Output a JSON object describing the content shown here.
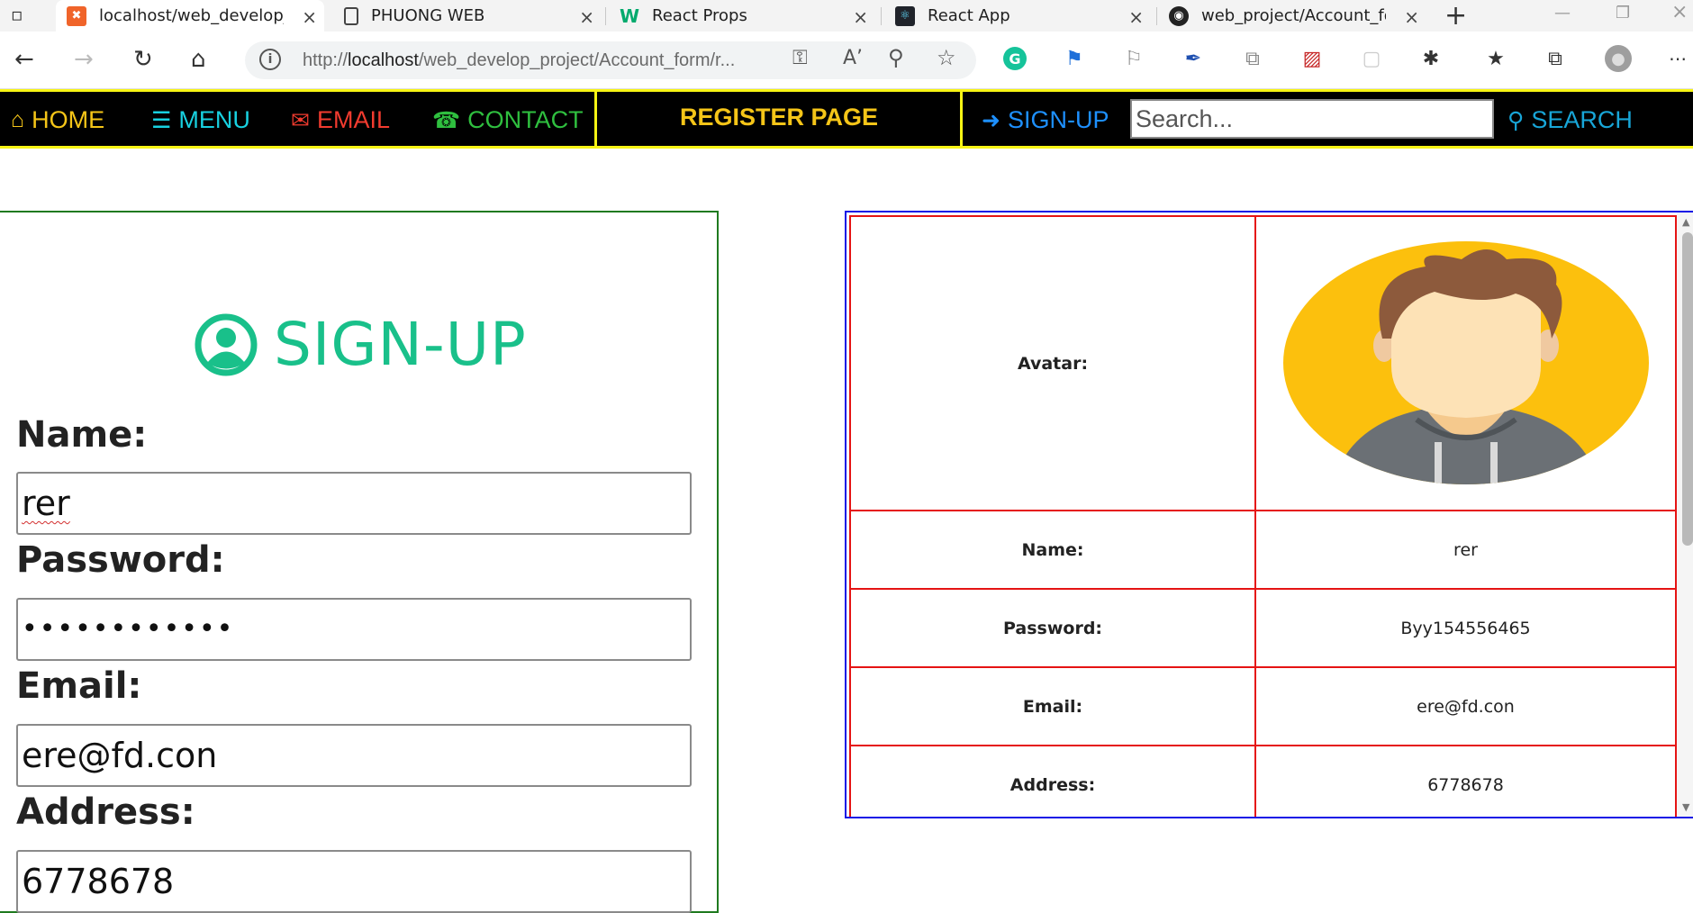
{
  "browser": {
    "tabs": [
      {
        "title": "localhost/web_develop_pr",
        "favicon": "xampp-icon",
        "active": true
      },
      {
        "title": "PHUONG WEB",
        "favicon": "page-icon",
        "active": false
      },
      {
        "title": "React Props",
        "favicon": "w3schools-icon",
        "active": false
      },
      {
        "title": "React App",
        "favicon": "react-icon",
        "active": false
      },
      {
        "title": "web_project/Account_form",
        "favicon": "github-icon",
        "active": false
      }
    ],
    "url_host_prefix": "http://",
    "url_host": "localhost",
    "url_path": "/web_develop_project/Account_form/r..."
  },
  "navbar": {
    "home": "HOME",
    "menu": "MENU",
    "email": "EMAIL",
    "contact": "CONTACT",
    "page_title": "REGISTER PAGE",
    "signup": "SIGN-UP",
    "search_placeholder": "Search...",
    "search_button": "SEARCH",
    "colors": {
      "border": "#f7f414",
      "home": "#f5c518",
      "menu": "#18d1e0",
      "email": "#f23b2f",
      "contact": "#2fbf3f",
      "signup": "#1e90ff",
      "search": "#18a6d8"
    }
  },
  "form": {
    "heading": "SIGN-UP",
    "name_label": "Name:",
    "name_value": "rer",
    "password_label": "Password:",
    "password_value": "••••••••••••",
    "email_label": "Email:",
    "email_value": "ere@fd.con",
    "address_label": "Address:",
    "address_value": "6778678"
  },
  "result": {
    "rows": [
      {
        "key": "Avatar:",
        "value": ""
      },
      {
        "key": "Name:",
        "value": "rer"
      },
      {
        "key": "Password:",
        "value": "Byy154556465"
      },
      {
        "key": "Email:",
        "value": "ere@fd.con"
      },
      {
        "key": "Address:",
        "value": "6778678"
      }
    ]
  }
}
